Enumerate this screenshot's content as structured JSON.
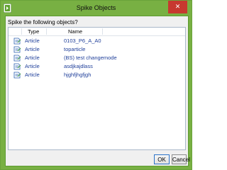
{
  "window": {
    "title": "Spike Objects",
    "close_label": "✕",
    "app_icon": "app-icon",
    "accent_color": "#78b043"
  },
  "prompt": "Spike the following objects?",
  "table": {
    "columns": [
      "Type",
      "Name"
    ],
    "rows": [
      {
        "icon": "article-icon",
        "type": "Article",
        "name": "0103_P6_A_A0"
      },
      {
        "icon": "article-icon",
        "type": "Article",
        "name": "toparticle"
      },
      {
        "icon": "article-icon",
        "type": "Article",
        "name": "(BS) test changemode"
      },
      {
        "icon": "article-icon",
        "type": "Article",
        "name": "asdjkajdlass"
      },
      {
        "icon": "article-icon",
        "type": "Article",
        "name": "hjghfjhgfjgh"
      }
    ]
  },
  "buttons": {
    "ok_label": "OK",
    "cancel_label": "Cancel"
  }
}
